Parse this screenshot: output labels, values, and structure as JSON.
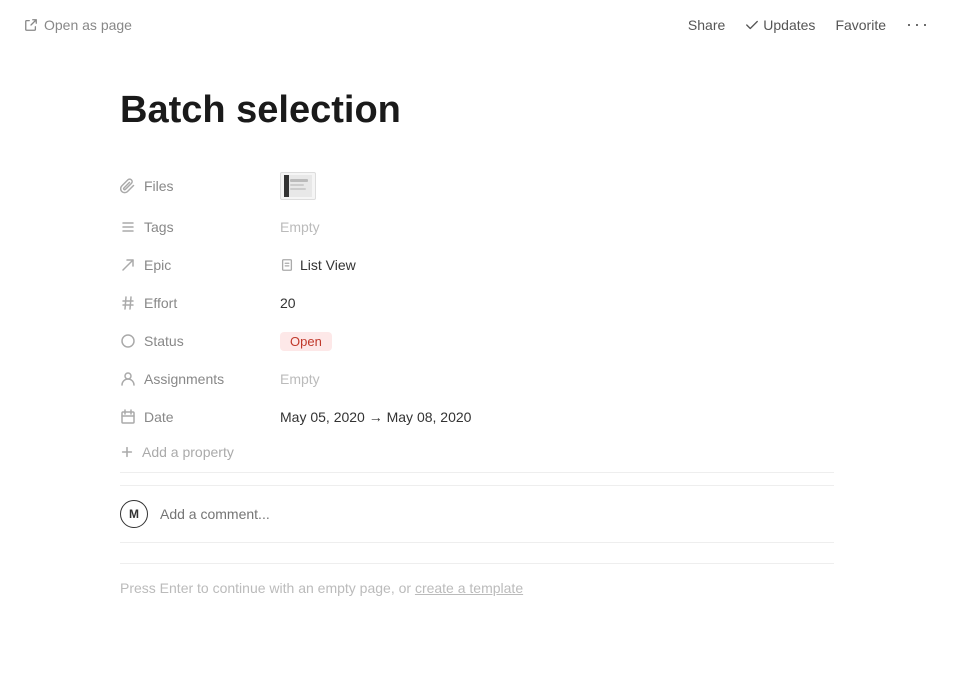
{
  "topbar": {
    "open_as_page": "Open as page",
    "share": "Share",
    "updates": "Updates",
    "favorite": "Favorite",
    "more": "···"
  },
  "page": {
    "title": "Batch selection"
  },
  "properties": [
    {
      "id": "files",
      "icon": "paperclip-icon",
      "label": "Files",
      "type": "file",
      "value": ""
    },
    {
      "id": "tags",
      "icon": "list-icon",
      "label": "Tags",
      "type": "empty",
      "value": "Empty"
    },
    {
      "id": "epic",
      "icon": "arrow-up-right-icon",
      "label": "Epic",
      "type": "ref",
      "value": "List View"
    },
    {
      "id": "effort",
      "icon": "hash-icon",
      "label": "Effort",
      "type": "number",
      "value": "20"
    },
    {
      "id": "status",
      "icon": "circle-icon",
      "label": "Status",
      "type": "badge",
      "value": "Open"
    },
    {
      "id": "assignments",
      "icon": "person-icon",
      "label": "Assignments",
      "type": "empty",
      "value": "Empty"
    },
    {
      "id": "date",
      "icon": "calendar-icon",
      "label": "Date",
      "type": "date",
      "value": "May 05, 2020 → May 08, 2020"
    }
  ],
  "add_property": {
    "label": "Add a property"
  },
  "comment": {
    "avatar_letter": "M",
    "placeholder": "Add a comment..."
  },
  "footer": {
    "text_before_link": "Press Enter to continue with an empty page, or ",
    "link_text": "create a template",
    "text_after_link": ""
  }
}
